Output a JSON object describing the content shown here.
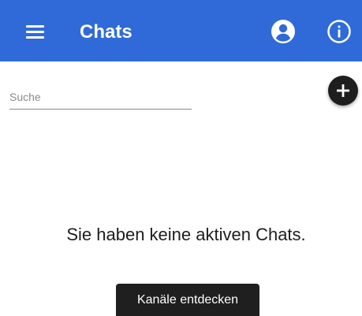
{
  "colors": {
    "appbar": "#2f6ad8",
    "fab": "#1e1e1e",
    "button": "#1f1f1f",
    "text": "#1d1d1d"
  },
  "appbar": {
    "title": "Chats",
    "menu_icon": "hamburger-menu-icon",
    "account_icon": "account-circle-icon",
    "info_icon": "info-icon"
  },
  "search": {
    "placeholder": "Suche",
    "value": ""
  },
  "fab": {
    "icon": "plus-icon"
  },
  "empty_state": {
    "message": "Sie haben keine aktiven Chats.",
    "button_label": "Kanäle entdecken"
  }
}
